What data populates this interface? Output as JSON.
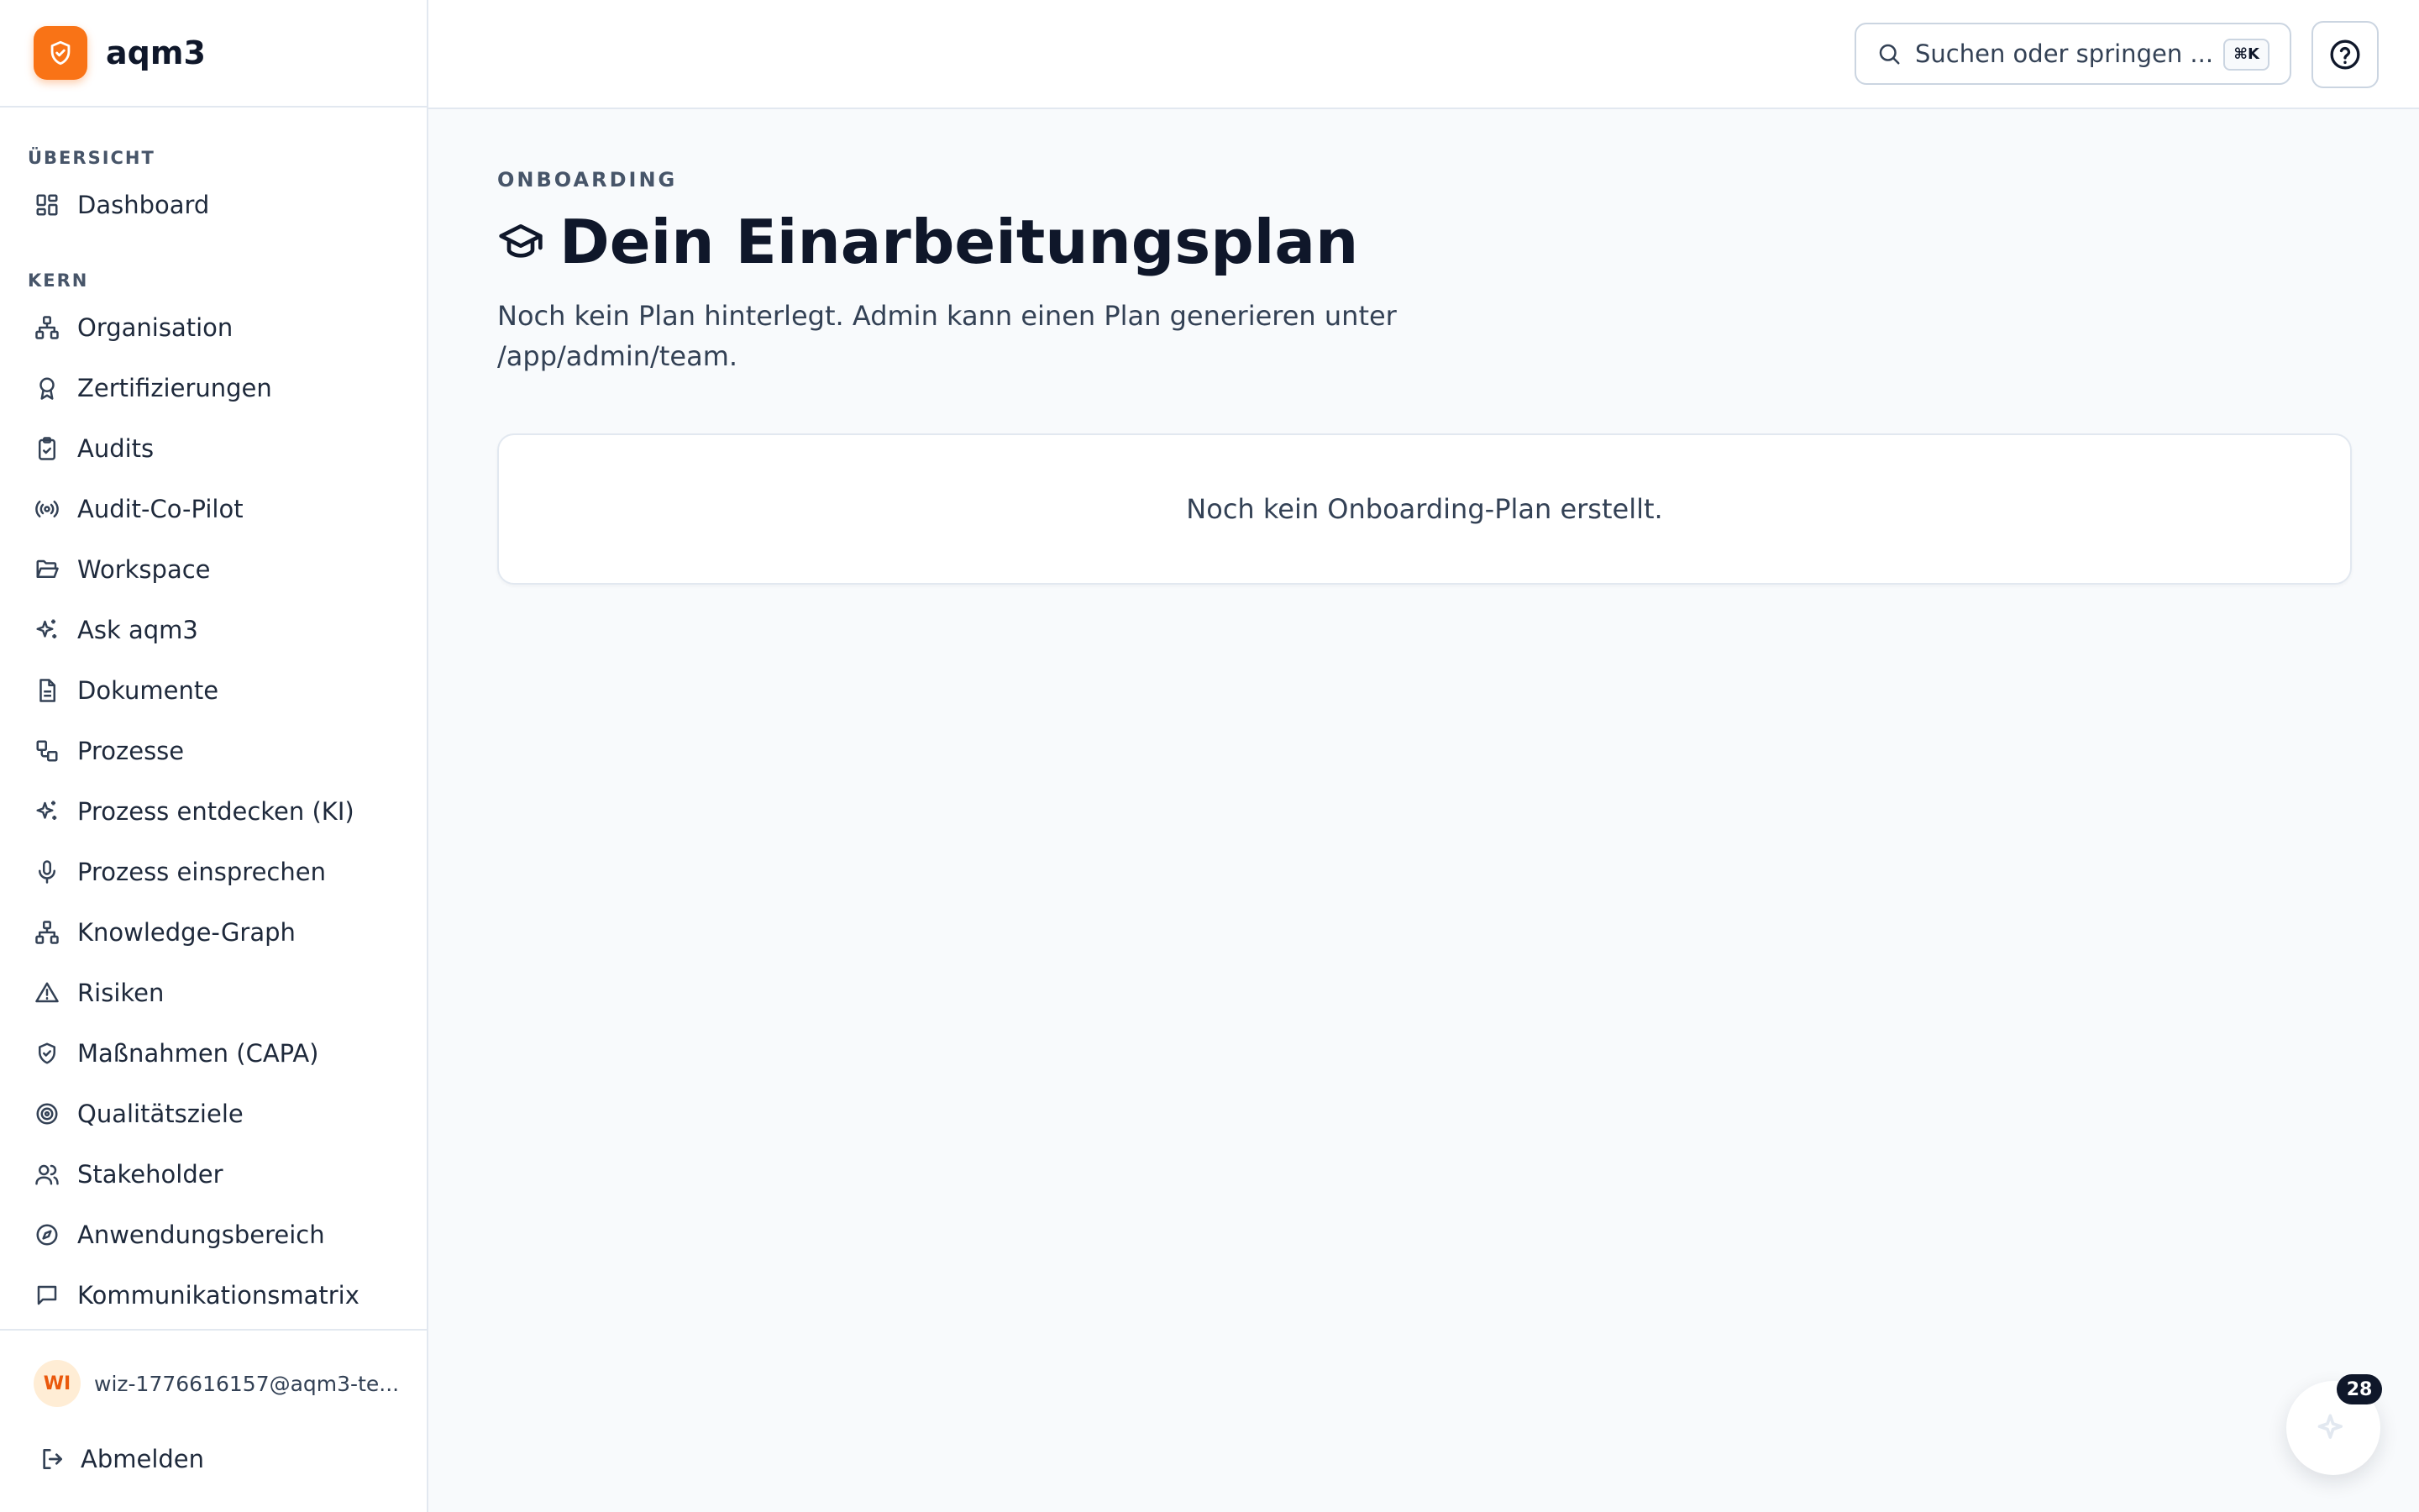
{
  "brand": {
    "name": "aqm3",
    "logo_icon": "shield-check-icon",
    "accent": "#f97316"
  },
  "sidebar": {
    "sections": [
      {
        "label": "ÜBERSICHT",
        "items": [
          {
            "label": "Dashboard",
            "icon": "dashboard-icon"
          }
        ]
      },
      {
        "label": "KERN",
        "items": [
          {
            "label": "Organisation",
            "icon": "org-chart-icon"
          },
          {
            "label": "Zertifizierungen",
            "icon": "award-icon"
          },
          {
            "label": "Audits",
            "icon": "clipboard-check-icon"
          },
          {
            "label": "Audit-Co-Pilot",
            "icon": "radio-icon"
          },
          {
            "label": "Workspace",
            "icon": "folder-open-icon"
          },
          {
            "label": "Ask aqm3",
            "icon": "sparkles-icon"
          },
          {
            "label": "Dokumente",
            "icon": "document-icon"
          },
          {
            "label": "Prozesse",
            "icon": "workflow-icon"
          },
          {
            "label": "Prozess entdecken (KI)",
            "icon": "sparkles-icon"
          },
          {
            "label": "Prozess einsprechen",
            "icon": "microphone-icon"
          },
          {
            "label": "Knowledge-Graph",
            "icon": "network-icon"
          },
          {
            "label": "Risiken",
            "icon": "warning-icon"
          },
          {
            "label": "Maßnahmen (CAPA)",
            "icon": "shield-check-icon"
          },
          {
            "label": "Qualitätsziele",
            "icon": "target-icon"
          },
          {
            "label": "Stakeholder",
            "icon": "users-icon"
          },
          {
            "label": "Anwendungsbereich",
            "icon": "compass-icon"
          },
          {
            "label": "Kommunikationsmatrix",
            "icon": "message-square-icon"
          }
        ]
      }
    ],
    "user": {
      "initials": "WI",
      "email": "wiz-1776616157@aqm3-te..."
    },
    "logout_label": "Abmelden"
  },
  "topbar": {
    "search": {
      "placeholder": "Suchen oder springen ...",
      "shortcut": "⌘K",
      "icon": "search-icon"
    },
    "help_icon": "help-circle-icon"
  },
  "main": {
    "eyebrow": "ONBOARDING",
    "title": "Dein Einarbeitungsplan",
    "title_icon": "graduation-cap-icon",
    "description": "Noch kein Plan hinterlegt. Admin kann einen Plan generieren unter /app/admin/team.",
    "empty_state": "Noch kein Onboarding-Plan erstellt."
  },
  "fab": {
    "badge": "28",
    "icon": "sparkles-icon"
  }
}
